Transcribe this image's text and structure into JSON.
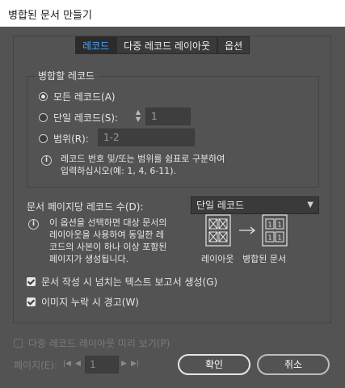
{
  "window": {
    "title": "병합된 문서 만들기"
  },
  "tabs": [
    {
      "label": "레코드",
      "active": true
    },
    {
      "label": "다중 레코드 레이아웃",
      "active": false
    },
    {
      "label": "옵션",
      "active": false
    }
  ],
  "records_group": {
    "legend": "병합할 레코드",
    "all_records": "모든 레코드(A)",
    "single_record": "단일 레코드(S):",
    "single_value": "1",
    "range": "범위(R):",
    "range_value": "1-2",
    "info_line1": "레코드 번호 및/또는 범위를 쉼표로 구분하여",
    "info_line2": "입력하십시오(예: 1, 4, 6-11).",
    "selected": "all"
  },
  "records_per_page": {
    "label": "문서 페이지당 레코드 수(D):",
    "value": "단일 레코드"
  },
  "layout_info": {
    "line1": "이 옵션을 선택하면 대상 문서의",
    "line2": "레이아웃을 사용하여 동일한 레",
    "line3": "코드의 사본이 하나 이상 포함된",
    "line4": "페이지가 생성됩니다."
  },
  "illustration": {
    "left_caption": "레이아웃",
    "right_caption": "병합된 문서",
    "left_glyph": "⊠",
    "right_glyph": "1"
  },
  "options": {
    "overset_report": {
      "label": "문서 작성 시 넘치는 텍스트 보고서 생성(G)",
      "checked": true
    },
    "missing_image_alert": {
      "label": "이미지 누락 시 경고(W)",
      "checked": true
    }
  },
  "preview": {
    "label": "다중 레코드 레이아웃 미리 보기(P)",
    "checked": false,
    "enabled": false
  },
  "pager": {
    "label": "페이지(E):",
    "first": "|◀",
    "prev": "◀",
    "value": "1",
    "next": "▶",
    "last": "▶|"
  },
  "buttons": {
    "ok": "확인",
    "cancel": "취소"
  },
  "colors": {
    "dialog_bg": "#535353",
    "accent_tab": "#4fa3f7",
    "titlebar": "#ffffff"
  }
}
